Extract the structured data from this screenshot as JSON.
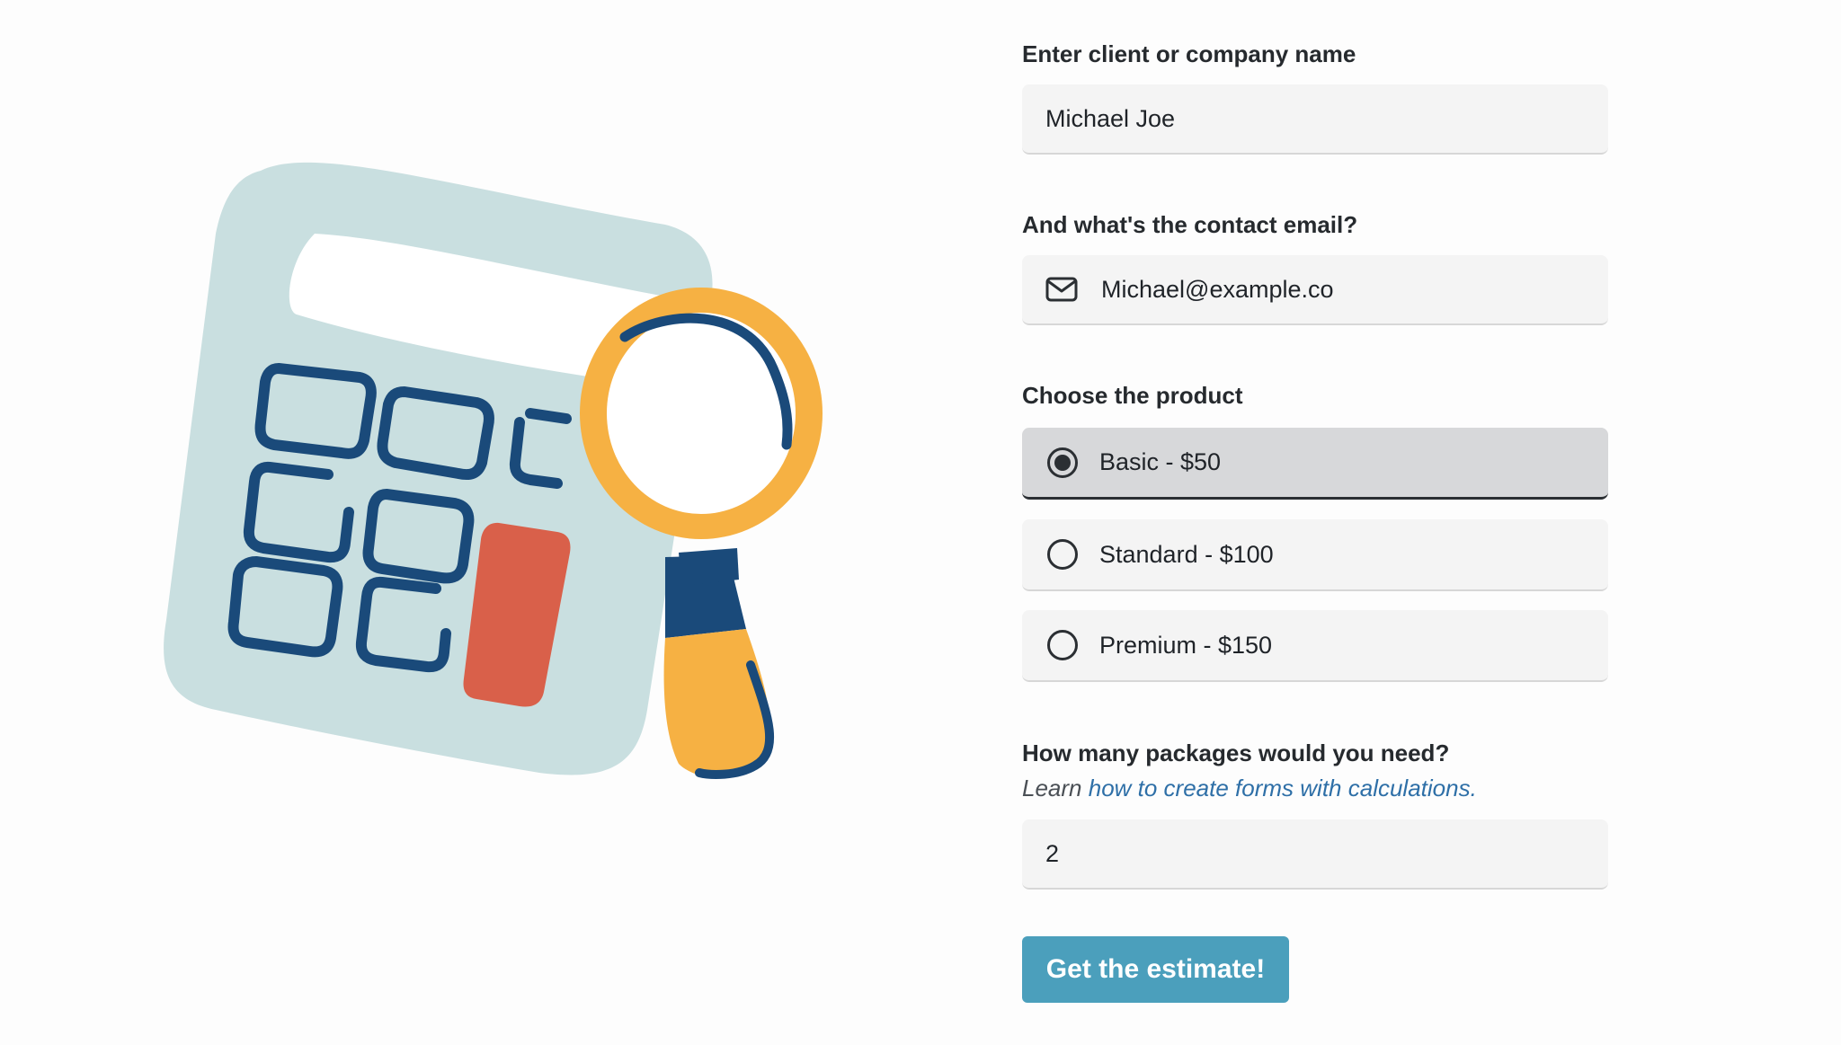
{
  "form": {
    "name": {
      "label": "Enter client or company name",
      "value": "Michael Joe"
    },
    "email": {
      "label": "And what's the contact email?",
      "value": "Michael@example.co",
      "icon": "mail-icon"
    },
    "product": {
      "label": "Choose the product",
      "options": [
        {
          "label": "Basic - $50",
          "selected": true
        },
        {
          "label": "Standard - $100",
          "selected": false
        },
        {
          "label": "Premium - $150",
          "selected": false
        }
      ]
    },
    "packages": {
      "label": "How many packages would you need?",
      "helper_prefix": "Learn ",
      "helper_link": "how to create forms with calculations.",
      "value": "2"
    },
    "submit_label": "Get the estimate!"
  },
  "colors": {
    "button": "#4b9fbc",
    "link": "#2e6fa7",
    "calculator_body": "#c9dfe0",
    "calculator_keys": "#1a4a7a",
    "accent_red": "#d9604a",
    "magnifier": "#f6b143"
  },
  "illustration": {
    "icon": "calculator-with-magnifier-illustration"
  }
}
